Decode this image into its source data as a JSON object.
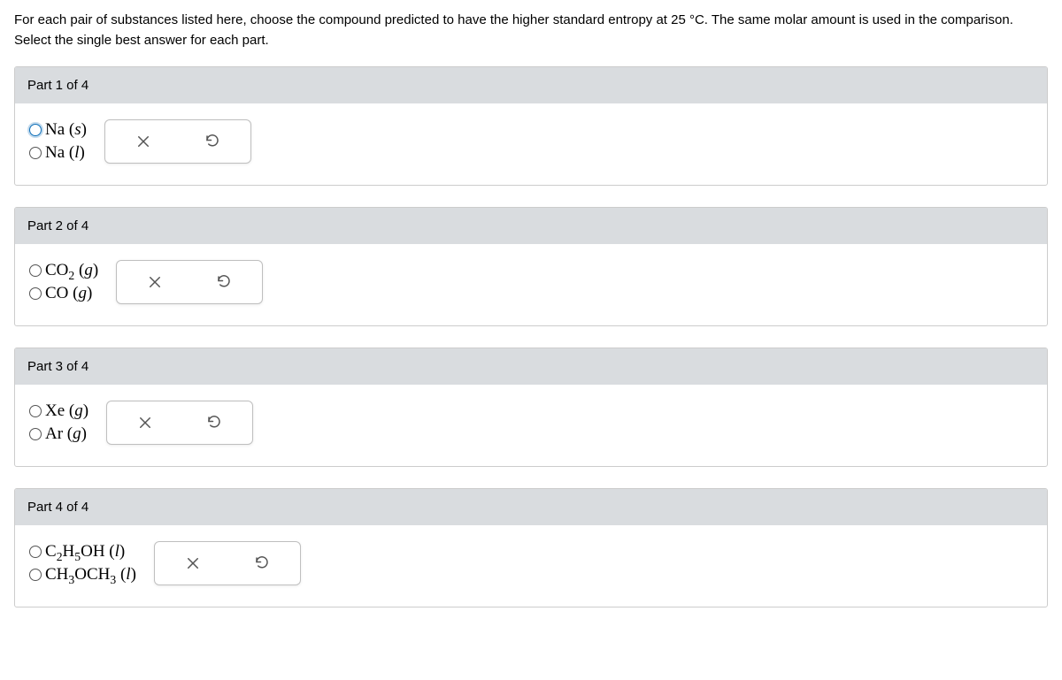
{
  "question": "For each pair of substances listed here, choose the compound predicted to have the higher standard entropy at 25 °C. The same molar amount is used in the comparison. Select the single best answer for each part.",
  "parts": [
    {
      "header": "Part 1 of 4",
      "options": [
        {
          "formula": "Na",
          "sub": "",
          "extra": "",
          "state": "s",
          "selected": true
        },
        {
          "formula": "Na",
          "sub": "",
          "extra": "",
          "state": "l",
          "selected": false
        }
      ]
    },
    {
      "header": "Part 2 of 4",
      "options": [
        {
          "formula": "CO",
          "sub": "2",
          "extra": "",
          "state": "g",
          "selected": false
        },
        {
          "formula": "CO",
          "sub": "",
          "extra": "",
          "state": "g",
          "selected": false
        }
      ]
    },
    {
      "header": "Part 3 of 4",
      "options": [
        {
          "formula": "Xe",
          "sub": "",
          "extra": "",
          "state": "g",
          "selected": false
        },
        {
          "formula": "Ar",
          "sub": "",
          "extra": "",
          "state": "g",
          "selected": false
        }
      ]
    },
    {
      "header": "Part 4 of 4",
      "options": [
        {
          "formula": "C",
          "sub": "2",
          "extra": "H<sub>5</sub>OH",
          "state": "l",
          "selected": false
        },
        {
          "formula": "CH",
          "sub": "3",
          "extra": "OCH<sub>3</sub>",
          "state": "l",
          "selected": false
        }
      ]
    }
  ],
  "buttons": {
    "clear": "×",
    "reset": "↺"
  }
}
